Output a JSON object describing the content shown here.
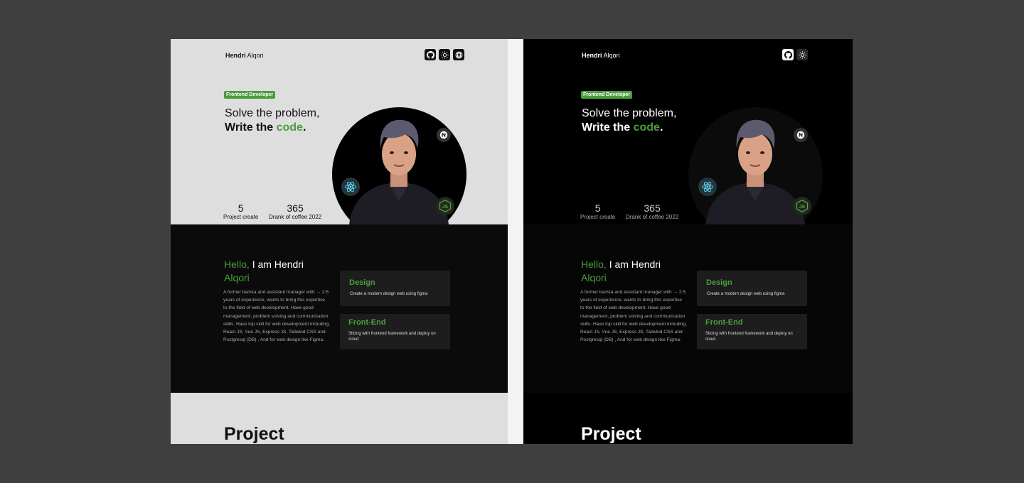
{
  "brand": {
    "first": "Hendri",
    "last": "Alqori"
  },
  "hero": {
    "badge": "Frontend Developer",
    "line1": "Solve the problem,",
    "line2_prefix": "Write the ",
    "line2_highlight": "code",
    "line2_suffix": ".",
    "stats": [
      {
        "value": "5",
        "label": "Project create"
      },
      {
        "value": "365",
        "label": "Drank of coffee 2022"
      }
    ]
  },
  "about": {
    "hello": "Hello,",
    "name": "I am Hendri",
    "name_highlight": "Alqori",
    "bio": "A former barista and assistant manager with → 2.5 years of experience, wants to bring this expertise to the field of web development. Have good management, problem solving and communication skills. Have top skill for web development including, React JS, Vue JS, Express JS, Tailwind CSS and Postgresql (DB) , And for web design like Figma."
  },
  "cards": [
    {
      "title": "Design",
      "desc": "Create a  modern design web using figma"
    },
    {
      "title": "Front-End",
      "desc": "Slicing with frontend framework and deploy on cloud"
    }
  ],
  "project": {
    "title": "Project"
  },
  "icons": {
    "left_nav": [
      "github-icon",
      "sun-icon",
      "globe-icon"
    ],
    "right_nav": [
      "github-icon",
      "sun-icon"
    ],
    "tech": [
      "nextjs-icon",
      "react-icon",
      "nodejs-icon"
    ]
  },
  "colors": {
    "accent": "#4a9e3c",
    "light_bg": "#dedede",
    "dark_bg": "#000000",
    "card_bg": "#1d1d1d",
    "outer_bg": "#3f3f3f"
  }
}
